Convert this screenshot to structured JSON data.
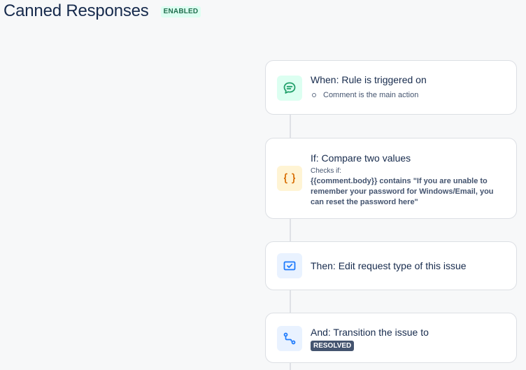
{
  "header": {
    "title": "Canned Responses",
    "status_badge": "ENABLED"
  },
  "rule": {
    "trigger": {
      "title": "When: Rule is triggered on",
      "detail": "Comment is the main action",
      "icon": "comment-icon",
      "color": "#22a06b"
    },
    "condition": {
      "title": "If: Compare two values",
      "checks_label": "Checks if:",
      "checks_value": "{{comment.body}} contains \"If you are unable to remember your password for Windows/Email, you can reset the password here\"",
      "icon": "braces-icon",
      "color": "#d97008"
    },
    "action_edit": {
      "title": "Then: Edit request type of this issue",
      "icon": "edit-request-type-icon",
      "color": "#1d7afc"
    },
    "action_transition": {
      "title": "And: Transition the issue to",
      "status": "RESOLVED",
      "icon": "transition-icon",
      "color": "#1d7afc"
    }
  },
  "colors": {
    "background": "#f7f8f9",
    "badge_bg": "#dcfff1",
    "badge_text": "#216e4e",
    "status_bg": "#44546f"
  }
}
